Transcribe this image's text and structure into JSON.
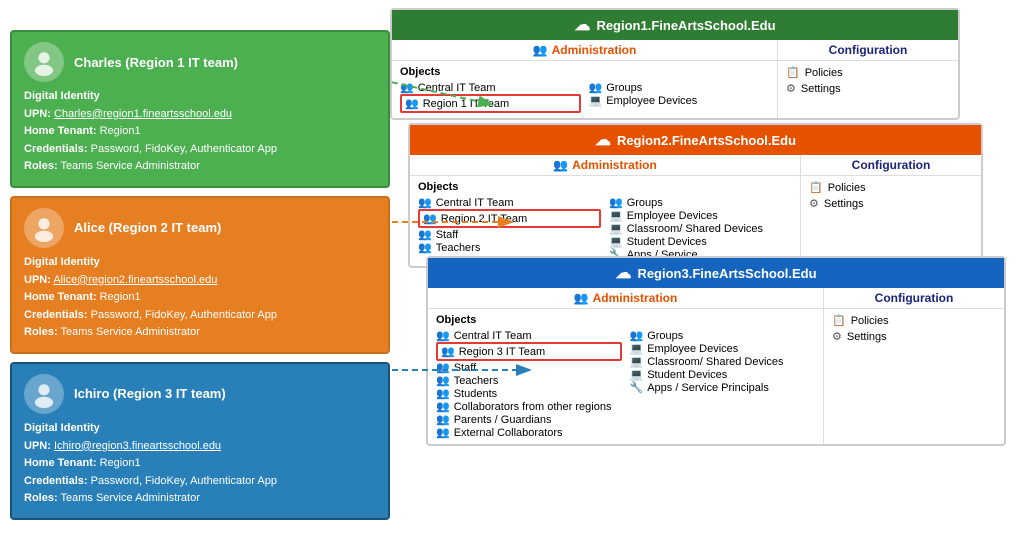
{
  "people": [
    {
      "id": "charles",
      "name": "Charles (Region 1 IT team)",
      "color": "green",
      "digital_identity": "Digital Identity",
      "upn_label": "UPN:",
      "upn": "Charles@region1.fineartsschool.edu",
      "home_tenant_label": "Home Tenant:",
      "home_tenant": "Region1",
      "credentials_label": "Credentials:",
      "credentials": "Password, FidoKey, Authenticator App",
      "roles_label": "Roles:",
      "roles": "Teams Service Administrator"
    },
    {
      "id": "alice",
      "name": "Alice (Region 2 IT team)",
      "color": "orange",
      "digital_identity": "Digital Identity",
      "upn_label": "UPN:",
      "upn": "Alice@region2.fineartsschool.edu",
      "home_tenant_label": "Home Tenant:",
      "home_tenant": "Region1",
      "credentials_label": "Credentials:",
      "credentials": "Password, FidoKey, Authenticator App",
      "roles_label": "Roles:",
      "roles": "Teams Service Administrator"
    },
    {
      "id": "ichiro",
      "name": "Ichiro (Region 3 IT team)",
      "color": "blue",
      "digital_identity": "Digital Identity",
      "upn_label": "UPN:",
      "upn": "Ichiro@region3.fineartsschool.edu",
      "home_tenant_label": "Home Tenant:",
      "home_tenant": "Region1",
      "credentials_label": "Credentials:",
      "credentials": "Password, FidoKey, Authenticator App",
      "roles_label": "Roles:",
      "roles": "Teams Service Administrator"
    }
  ],
  "tenants": [
    {
      "id": "region1",
      "title": "Region1.FineArtsSchool.Edu",
      "header_color": "#2E7D32",
      "objects": {
        "col1": [
          "Central IT Team",
          "Region 1 IT Team"
        ],
        "col2": [
          "Groups",
          "Employee Devices"
        ]
      },
      "highlighted": "Region 1 IT Team",
      "config": [
        "Policies",
        "Settings"
      ]
    },
    {
      "id": "region2",
      "title": "Region2.FineArtsSchool.Edu",
      "header_color": "#E65100",
      "objects": {
        "col1": [
          "Central IT Team",
          "Region 2 IT Team",
          "Staff",
          "Teachers"
        ],
        "col2": [
          "Groups",
          "Employee Devices",
          "Classroom/ Shared Devices",
          "Student Devices",
          "Apps / Service"
        ]
      },
      "highlighted": "Region 2 IT Team",
      "config": [
        "Policies",
        "Settings"
      ]
    },
    {
      "id": "region3",
      "title": "Region3.FineArtsSchool.Edu",
      "header_color": "#1565C0",
      "objects": {
        "col1": [
          "Central IT Team",
          "Region 3 IT Team",
          "Staff",
          "Teachers",
          "Students",
          "Collaborators from other regions",
          "Parents / Guardians",
          "External Collaborators"
        ],
        "col2": [
          "Groups",
          "Employee Devices",
          "Classroom/ Shared Devices",
          "Student Devices",
          "Apps / Service Principals"
        ]
      },
      "highlighted": "Region 3 IT Team",
      "config": [
        "Policies",
        "Settings"
      ]
    }
  ],
  "icons": {
    "cloud": "☁",
    "person_group": "👥",
    "person": "👤",
    "policy": "📋",
    "settings": "⚙",
    "device": "💻",
    "group": "👥"
  },
  "labels": {
    "administration": "Administration",
    "configuration": "Configuration",
    "objects": "Objects"
  }
}
